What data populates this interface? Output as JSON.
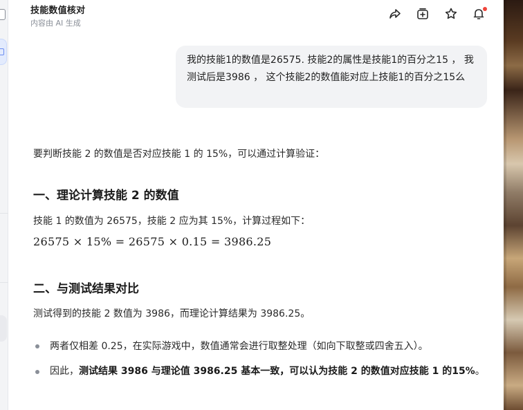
{
  "header": {
    "title": "技能数值核对",
    "subtitle": "内容由 AI 生成"
  },
  "toolbar": {
    "icons": [
      "share-icon",
      "add-to-collection-icon",
      "star-icon",
      "bell-icon"
    ],
    "accent_dot_color": "#f0443a"
  },
  "user_message": {
    "text": "我的技能1的数值是26575. 技能2的属性是技能1的百分之15 ，  我测试后是3986  ，  这个技能2的数值能对应上技能1的百分之15么"
  },
  "answer": {
    "intro": "要判断技能 2 的数值是否对应技能 1 的 15%，可以通过计算验证：",
    "section1_title": "一、理论计算技能 2 的数值",
    "section1_text": "技能 1 的数值为 26575，技能 2 应为其 15%，计算过程如下：",
    "formula": "26575 × 15% = 26575 × 0.15 = 3986.25",
    "section2_title": "二、与测试结果对比",
    "section2_text": "测试得到的技能 2 数值为 3986，而理论计算结果为 3986.25。",
    "bullet1": "两者仅相差 0.25，在实际游戏中，数值通常会进行取整处理（如向下取整或四舍五入）。",
    "bullet2_prefix": "因此，",
    "bullet2_bold": "测试结果 3986 与理论值 3986.25 基本一致，可以认为技能 2 的数值对应技能 1 的15%",
    "bullet2_suffix": "。"
  }
}
